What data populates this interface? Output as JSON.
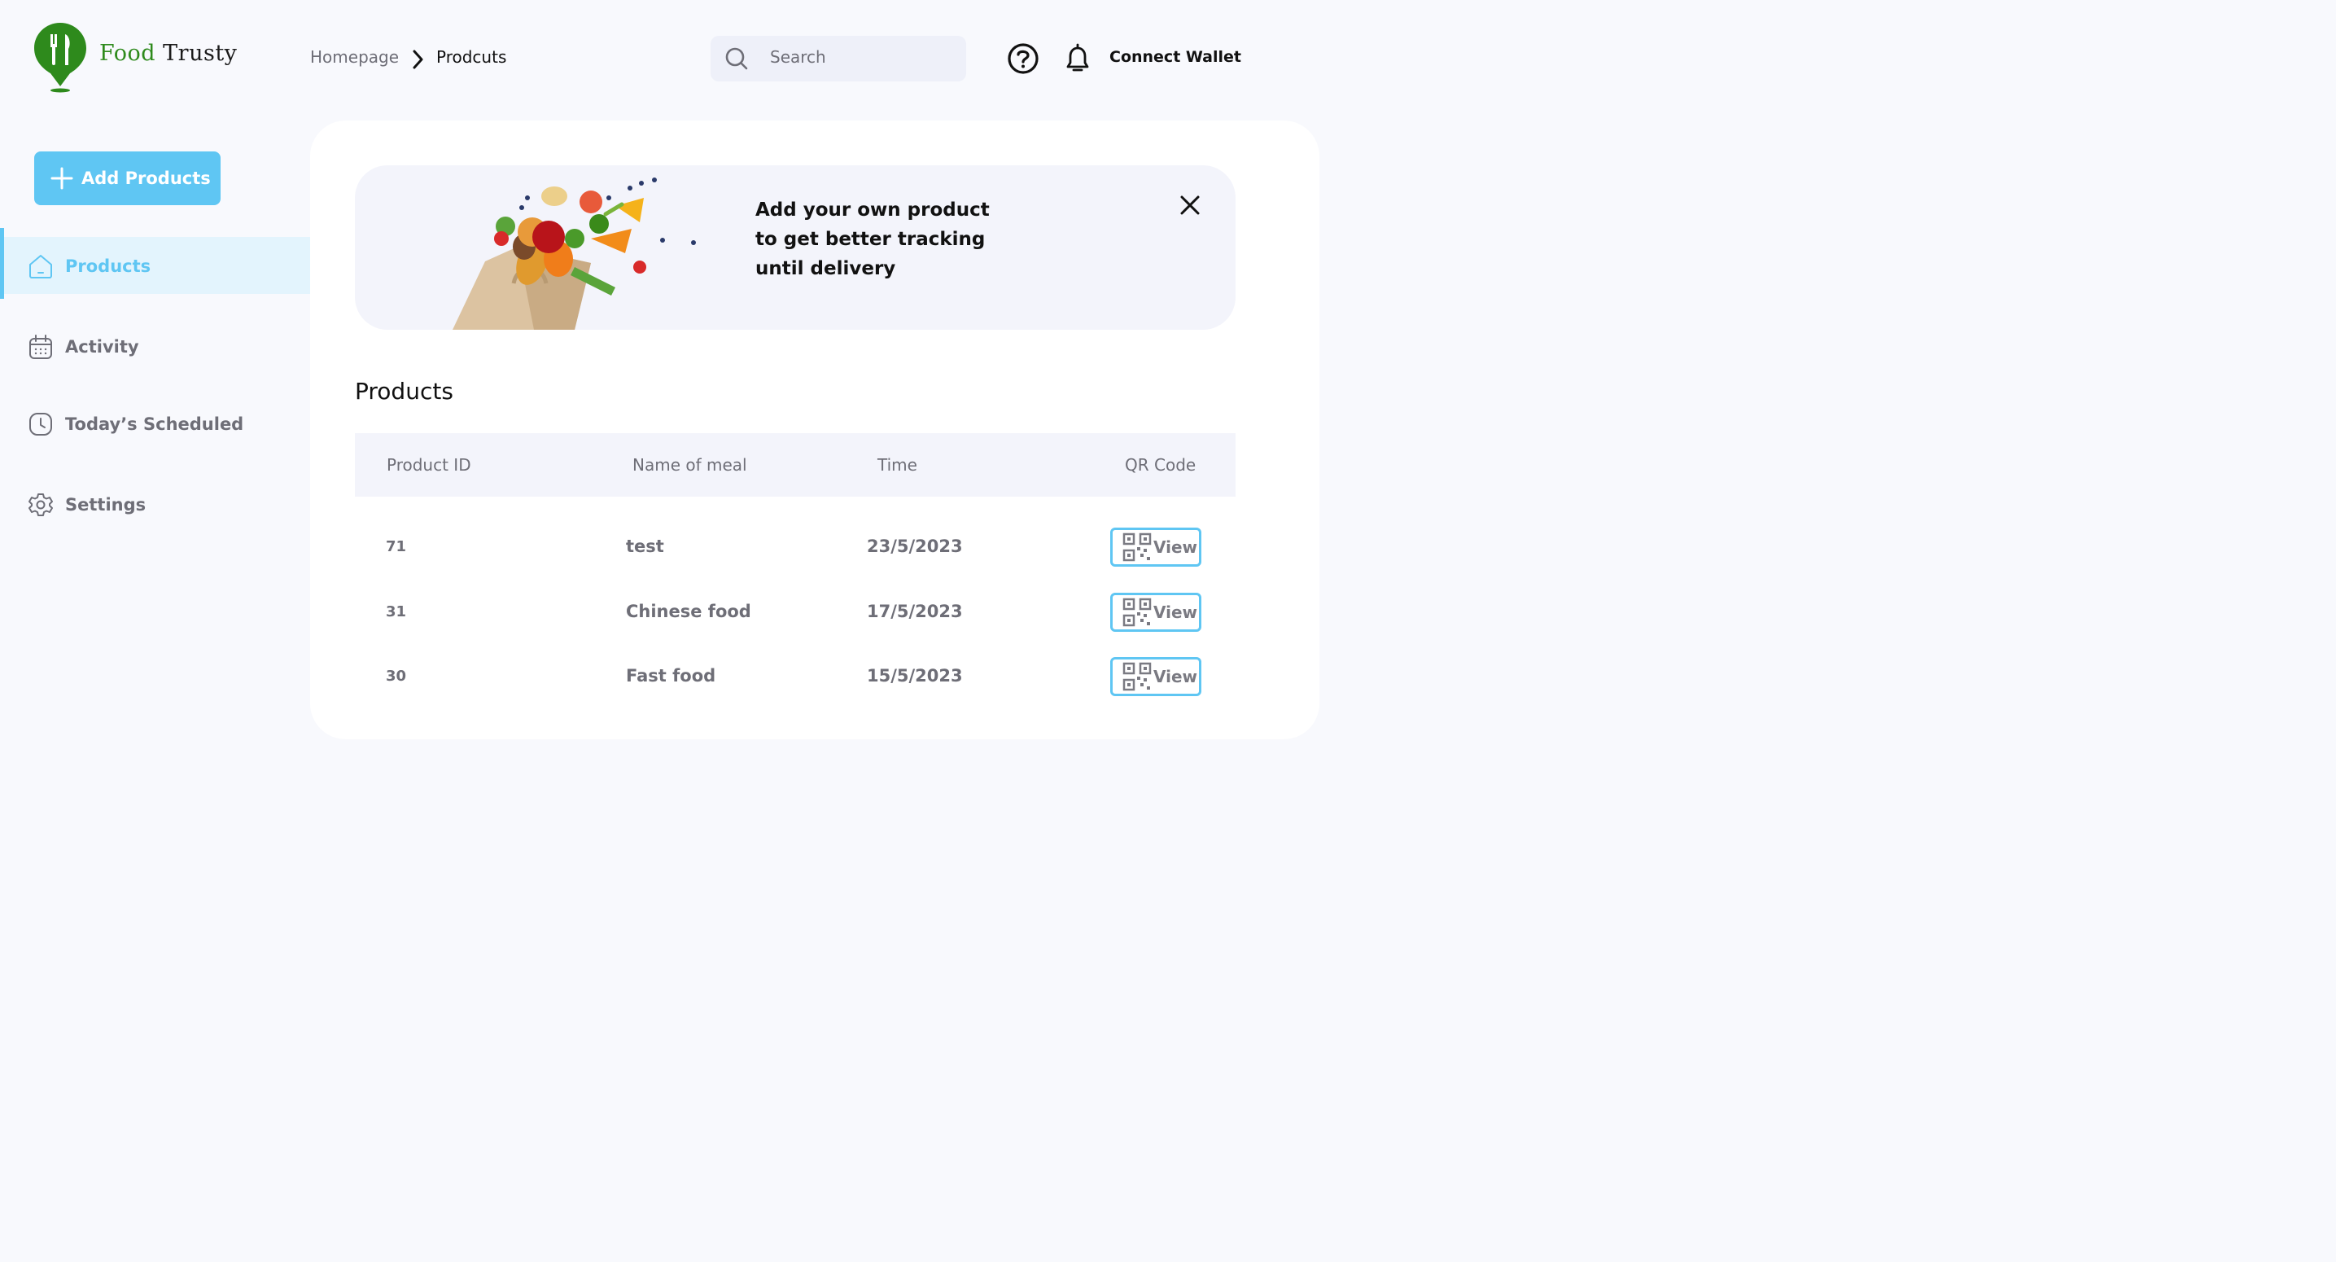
{
  "brand": {
    "word1": "Food",
    "word2": "Trusty"
  },
  "breadcrumb": {
    "home": "Homepage",
    "current": "Prodcuts"
  },
  "search": {
    "placeholder": "Search"
  },
  "header": {
    "connect_wallet": "Connect Wallet"
  },
  "sidebar": {
    "add_button": "Add Products",
    "items": [
      {
        "label": "Products",
        "icon": "home-icon",
        "active": true
      },
      {
        "label": "Activity",
        "icon": "calendar-icon",
        "active": false
      },
      {
        "label": "Today’s Scheduled",
        "icon": "clock-icon",
        "active": false
      },
      {
        "label": "Settings",
        "icon": "gear-icon",
        "active": false
      }
    ]
  },
  "banner": {
    "line1": "Add your own product",
    "line2": "to get better tracking",
    "line3": "until delivery"
  },
  "products": {
    "title": "Products",
    "columns": [
      "Product ID",
      "Name of meal",
      "Time",
      "QR Code"
    ],
    "rows": [
      {
        "id": "71",
        "name": "test",
        "time": "23/5/2023",
        "action": "View"
      },
      {
        "id": "31",
        "name": "Chinese food",
        "time": "17/5/2023",
        "action": "View"
      },
      {
        "id": "30",
        "name": "Fast food",
        "time": "15/5/2023",
        "action": "View"
      }
    ]
  },
  "colors": {
    "accent": "#5fc6f3",
    "brand_green": "#2e8a1c",
    "background": "#f8f9fd"
  }
}
